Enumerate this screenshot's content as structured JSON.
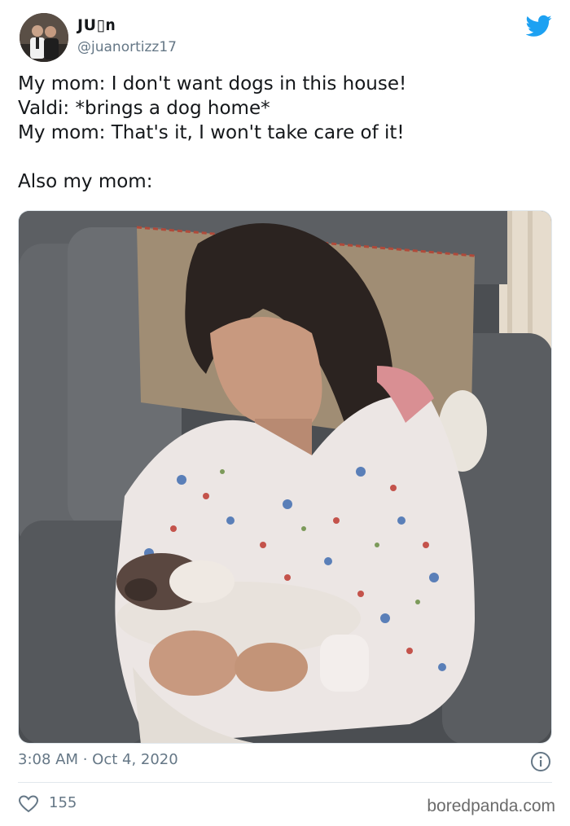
{
  "author": {
    "display_name": "JU▯ո",
    "handle": "@juanortizz17",
    "avatar_icon": "profile-photo"
  },
  "tweet": {
    "lines": [
      "My mom: I don't want dogs in this house!",
      "Valdi: *brings a dog home*",
      "My mom: That's it, I won't take care of it!",
      "Also my mom:"
    ],
    "media_description_icon": "photo"
  },
  "meta": {
    "timestamp": "3:08 AM · Oct 4, 2020",
    "likes": "155"
  },
  "watermark": "boredpanda.com",
  "colors": {
    "twitter_blue": "#1da1f2",
    "secondary_text": "#657786",
    "primary_text": "#14171a"
  }
}
